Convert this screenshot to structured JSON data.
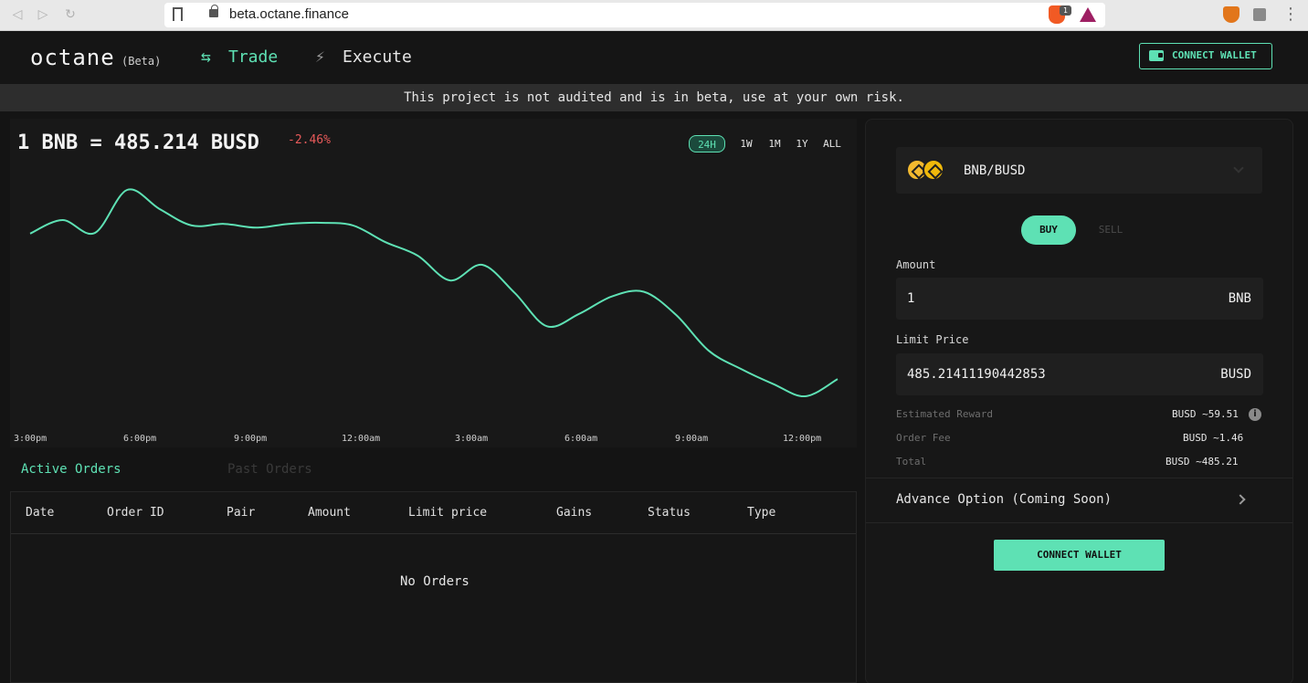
{
  "browser": {
    "url": "beta.octane.finance",
    "brave_badge": "1"
  },
  "header": {
    "logo": "octane",
    "logo_tag": "(Beta)",
    "nav": [
      {
        "label": "Trade",
        "icon": "swap-arrows-icon",
        "active": true
      },
      {
        "label": "Execute",
        "icon": "lightning-bolt-icon",
        "active": false
      }
    ],
    "connect_wallet": "CONNECT WALLET"
  },
  "banner": {
    "text": "This project is not audited and is in beta, use at your own risk."
  },
  "chart": {
    "price_text": "1 BNB = 485.214 BUSD",
    "change": "-2.46%",
    "ranges": [
      "24H",
      "1W",
      "1M",
      "1Y",
      "ALL"
    ],
    "active_range": "24H",
    "x_ticks": [
      "3:00pm",
      "6:00pm",
      "9:00pm",
      "12:00am",
      "3:00am",
      "6:00am",
      "9:00am",
      "12:00pm"
    ],
    "line_color": "#5ee1b4",
    "change_color": "#e85a5a"
  },
  "chart_data": {
    "type": "line",
    "title": "",
    "xlabel": "",
    "ylabel": "",
    "x": [
      "3:00pm",
      "",
      "",
      "",
      "6:00pm",
      "",
      "",
      "",
      "9:00pm",
      "",
      "",
      "",
      "12:00am",
      "",
      "",
      "",
      "3:00am",
      "",
      "",
      "",
      "6:00am",
      "",
      "",
      "",
      "9:00am",
      "",
      "",
      "",
      "12:00pm",
      ""
    ],
    "series": [
      {
        "values": [
          497.5,
          500.0,
          497.6,
          505.6,
          502.1,
          499.0,
          499.3,
          498.6,
          499.3,
          499.5,
          499.0,
          495.9,
          493.4,
          488.8,
          491.7,
          486.5,
          480.3,
          482.6,
          485.8,
          486.7,
          482.4,
          475.8,
          472.4,
          469.6,
          467.3,
          470.5
        ]
      }
    ],
    "grid": false,
    "legend": "none"
  },
  "orders": {
    "tabs": [
      "Active Orders",
      "Past Orders"
    ],
    "columns": [
      "Date",
      "Order ID",
      "Pair",
      "Amount",
      "Limit price",
      "Gains",
      "Status",
      "Type"
    ],
    "empty_text": "No Orders"
  },
  "trade_form": {
    "pair": "BNB/BUSD",
    "buy_label": "BUY",
    "sell_label": "SELL",
    "amount_label": "Amount",
    "amount_value": "1",
    "amount_unit": "BNB",
    "limit_label": "Limit Price",
    "limit_value": "485.21411190442853",
    "limit_unit": "BUSD",
    "summary": [
      {
        "label": "Estimated Reward",
        "value": "BUSD ~59.51"
      },
      {
        "label": "Order Fee",
        "value": "BUSD ~1.46"
      },
      {
        "label": "Total",
        "value": "BUSD ~485.21"
      }
    ],
    "advance_option": "Advance Option (Coming Soon)",
    "connect_wallet": "CONNECT WALLET"
  }
}
